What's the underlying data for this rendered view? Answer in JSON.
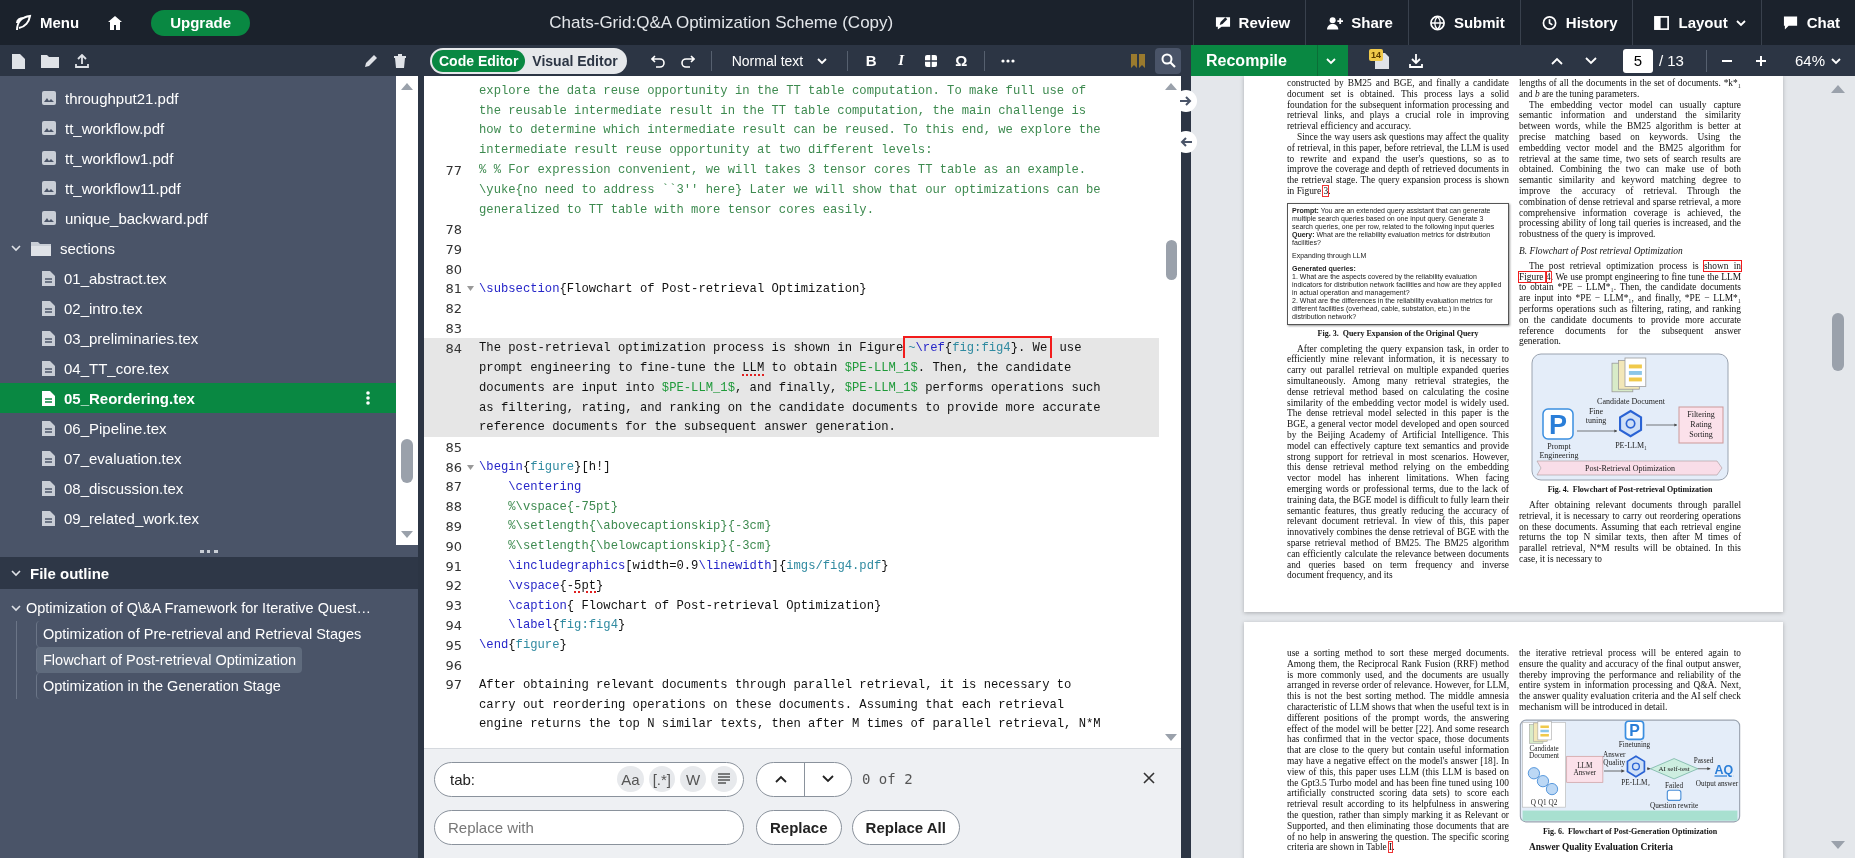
{
  "menu_bar": {
    "menu": "Menu",
    "upgrade": "Upgrade",
    "title": "Chats-Grid:Q&A Optimization Scheme (Copy)",
    "actions": [
      {
        "kind": "review",
        "label": "Review",
        "dropdown": false
      },
      {
        "kind": "share",
        "label": "Share",
        "dropdown": false
      },
      {
        "kind": "submit",
        "label": "Submit",
        "dropdown": false
      },
      {
        "kind": "history",
        "label": "History",
        "dropdown": false
      },
      {
        "kind": "layout",
        "label": "Layout",
        "dropdown": true
      },
      {
        "kind": "chat",
        "label": "Chat",
        "dropdown": false
      }
    ]
  },
  "file_tree": {
    "items": [
      {
        "kind": "image",
        "name": "throughput21.pdf",
        "selected": false
      },
      {
        "kind": "image",
        "name": "tt_workflow.pdf",
        "selected": false
      },
      {
        "kind": "image",
        "name": "tt_workflow1.pdf",
        "selected": false
      },
      {
        "kind": "image",
        "name": "tt_workflow11.pdf",
        "selected": false
      },
      {
        "kind": "image",
        "name": "unique_backward.pdf",
        "selected": false
      },
      {
        "kind": "folder",
        "name": "sections",
        "expanded": true,
        "selected": false,
        "children": [
          {
            "kind": "tex",
            "name": "01_abstract.tex",
            "selected": false
          },
          {
            "kind": "tex",
            "name": "02_intro.tex",
            "selected": false
          },
          {
            "kind": "tex",
            "name": "03_preliminaries.tex",
            "selected": false
          },
          {
            "kind": "tex",
            "name": "04_TT_core.tex",
            "selected": false
          },
          {
            "kind": "tex",
            "name": "05_Reordering.tex",
            "selected": true
          },
          {
            "kind": "tex",
            "name": "06_Pipeline.tex",
            "selected": false
          },
          {
            "kind": "tex",
            "name": "07_evaluation.tex",
            "selected": false
          },
          {
            "kind": "tex",
            "name": "08_discussion.tex",
            "selected": false
          },
          {
            "kind": "tex",
            "name": "09_related_work.tex",
            "selected": false
          }
        ]
      }
    ]
  },
  "file_outline": {
    "title": "File outline",
    "expanded": true,
    "items": [
      {
        "title": "Optimization of Q\\&A Framework for Iterative Quest…",
        "selected": false,
        "expanded": true,
        "children": [
          {
            "title": "Optimization of Pre-retrieval and Retrieval Stages",
            "selected": false
          },
          {
            "title": "Flowchart of Post-retrieval Optimization",
            "selected": true
          },
          {
            "title": "Optimization in the Generation Stage",
            "selected": false
          }
        ]
      }
    ]
  },
  "editor_toolbar": {
    "modes": [
      {
        "label": "Code Editor",
        "selected": true
      },
      {
        "label": "Visual Editor",
        "selected": false
      }
    ],
    "text_style": "Normal text",
    "bold": "B",
    "italic": "I",
    "symbol": "Ω",
    "search_open": true
  },
  "editor": {
    "lines": [
      {
        "active": false,
        "segments": [
          {
            "kind": "comment",
            "text": "explore the data reuse opportunity in the TT table computation. To make full use of"
          }
        ]
      },
      {
        "active": false,
        "segments": [
          {
            "kind": "comment",
            "text": "the reusable intermediate result in the TT table computation, the main challenge is"
          }
        ]
      },
      {
        "active": false,
        "segments": [
          {
            "kind": "comment",
            "text": "how to determine which intermediate result can be reused. To this end, we explore the"
          }
        ]
      },
      {
        "active": false,
        "segments": [
          {
            "kind": "comment",
            "text": "intermediate result reuse opportunity at two different levels:"
          }
        ]
      },
      {
        "number": "77",
        "active": false,
        "foldable": false,
        "segments": [
          {
            "kind": "comment",
            "text": "% % For expression convenient, we will takes 3 tensor cores TT table as an example."
          }
        ]
      },
      {
        "active": false,
        "segments": [
          {
            "kind": "comment",
            "text": "\\yuke{no need to address ``3'' here} Later we will show that our optimizations can be"
          }
        ]
      },
      {
        "active": false,
        "segments": [
          {
            "kind": "comment",
            "text": "generalized to TT table with more tensor cores easily."
          }
        ]
      },
      {
        "number": "78",
        "active": false,
        "foldable": false
      },
      {
        "number": "79",
        "active": false,
        "foldable": false
      },
      {
        "number": "80",
        "active": false,
        "foldable": false
      },
      {
        "number": "81",
        "active": false,
        "foldable": true,
        "segments": [
          {
            "kind": "command",
            "text": "\\subsection"
          },
          {
            "kind": "text",
            "text": "{Flowchart of Post-retrieval Optimization}"
          }
        ]
      },
      {
        "number": "82",
        "active": false,
        "foldable": false
      },
      {
        "number": "83",
        "active": false,
        "foldable": false
      },
      {
        "number": "84",
        "active": true,
        "foldable": false,
        "segments": [
          {
            "kind": "text",
            "text": "The post-retrieval optimization process is shown in Figure"
          },
          {
            "kind": "annotation",
            "segments": [
              {
                "kind": "argument",
                "text": "~"
              },
              {
                "kind": "command",
                "text": "\\ref"
              },
              {
                "kind": "text",
                "text": "{"
              },
              {
                "kind": "argument",
                "text": "fig:fig4"
              },
              {
                "kind": "text",
                "text": "}. We"
              }
            ]
          },
          {
            "kind": "text",
            "text": " use"
          }
        ]
      },
      {
        "active": true,
        "segments": [
          {
            "kind": "text",
            "text": "prompt engineering to fine-tune the "
          },
          {
            "kind": "misspelled",
            "text": "LLM"
          },
          {
            "kind": "text",
            "text": " to obtain "
          },
          {
            "kind": "math",
            "text": "$PE-LLM_1$"
          },
          {
            "kind": "text",
            "text": ". Then, the candidate"
          }
        ]
      },
      {
        "active": true,
        "segments": [
          {
            "kind": "text",
            "text": "documents are input into "
          },
          {
            "kind": "math",
            "text": "$PE-LLM_1$"
          },
          {
            "kind": "text",
            "text": ", and finally, "
          },
          {
            "kind": "math",
            "text": "$PE-LLM_1$"
          },
          {
            "kind": "text",
            "text": " performs operations such"
          }
        ]
      },
      {
        "active": true,
        "segments": [
          {
            "kind": "text",
            "text": "as filtering, rating, and ranking on the candidate documents to provide more accurate"
          }
        ]
      },
      {
        "active": true,
        "segments": [
          {
            "kind": "text",
            "text": "reference documents for the subsequent answer generation."
          }
        ]
      },
      {
        "number": "85",
        "active": false,
        "foldable": false
      },
      {
        "number": "86",
        "active": false,
        "foldable": true,
        "segments": [
          {
            "kind": "command",
            "text": "\\begin"
          },
          {
            "kind": "text",
            "text": "{"
          },
          {
            "kind": "argument",
            "text": "figure"
          },
          {
            "kind": "text",
            "text": "}[h!]"
          }
        ]
      },
      {
        "number": "87",
        "active": false,
        "foldable": false,
        "segments": [
          {
            "kind": "command",
            "text": "    \\centering"
          }
        ]
      },
      {
        "number": "88",
        "active": false,
        "foldable": false,
        "segments": [
          {
            "kind": "comment",
            "text": "    %\\vspace{-75pt}"
          }
        ]
      },
      {
        "number": "89",
        "active": false,
        "foldable": false,
        "segments": [
          {
            "kind": "comment",
            "text": "    %\\setlength{\\abovecaptionskip}{-3cm}"
          }
        ]
      },
      {
        "number": "90",
        "active": false,
        "foldable": false,
        "segments": [
          {
            "kind": "comment",
            "text": "    %\\setlength{\\belowcaptionskip}{-3cm}"
          }
        ]
      },
      {
        "number": "91",
        "active": false,
        "foldable": false,
        "segments": [
          {
            "kind": "command",
            "text": "    \\includegraphics"
          },
          {
            "kind": "text",
            "text": "[width=0.9"
          },
          {
            "kind": "command",
            "text": "\\linewidth"
          },
          {
            "kind": "text",
            "text": "]{"
          },
          {
            "kind": "argument",
            "text": "imgs/fig4.pdf"
          },
          {
            "kind": "text",
            "text": "}"
          }
        ]
      },
      {
        "number": "92",
        "active": false,
        "foldable": false,
        "segments": [
          {
            "kind": "command",
            "text": "    \\vspace"
          },
          {
            "kind": "text",
            "text": "{-"
          },
          {
            "kind": "misspelled",
            "text": "5pt"
          },
          {
            "kind": "text",
            "text": "}"
          }
        ]
      },
      {
        "number": "93",
        "active": false,
        "foldable": false,
        "segments": [
          {
            "kind": "command",
            "text": "    \\caption"
          },
          {
            "kind": "text",
            "text": "{ Flowchart of Post-retrieval Optimization}"
          }
        ]
      },
      {
        "number": "94",
        "active": false,
        "foldable": false,
        "segments": [
          {
            "kind": "command",
            "text": "    \\label"
          },
          {
            "kind": "text",
            "text": "{"
          },
          {
            "kind": "argument",
            "text": "fig:fig4"
          },
          {
            "kind": "text",
            "text": "}"
          }
        ]
      },
      {
        "number": "95",
        "active": false,
        "foldable": false,
        "segments": [
          {
            "kind": "command",
            "text": "\\end"
          },
          {
            "kind": "text",
            "text": "{"
          },
          {
            "kind": "argument",
            "text": "figure"
          },
          {
            "kind": "text",
            "text": "}"
          }
        ]
      },
      {
        "number": "96",
        "active": false,
        "foldable": false
      },
      {
        "number": "97",
        "active": false,
        "foldable": false,
        "segments": [
          {
            "kind": "text",
            "text": "After obtaining relevant documents through parallel retrieval, it is necessary to"
          }
        ]
      },
      {
        "active": false,
        "segments": [
          {
            "kind": "text",
            "text": "carry out reordering operations on these documents. Assuming that each retrieval"
          }
        ]
      },
      {
        "active": false,
        "segments": [
          {
            "kind": "text",
            "text": "engine returns the top N similar texts, then after M times of parallel retrieval, N*M"
          }
        ]
      }
    ]
  },
  "search": {
    "query": "tab:",
    "options": [
      "Aa",
      "[.*]",
      "W"
    ],
    "match_count": "0 of 2",
    "replace_placeholder": "Replace with",
    "buttons": [
      "Replace",
      "Replace All"
    ]
  },
  "pdf_toolbar": {
    "recompile": "Recompile",
    "log_count": "14",
    "page": "5",
    "page_total": "/ 13",
    "zoom": "64%"
  },
  "pdf": {
    "pages": [
      {
        "columns": [
          [
            {
              "kind": "para",
              "indent": false,
              "text": "constructed by BM25 and BGE, and finally a candidate document set is obtained. This process lays a solid foundation for the subsequent information processing and retrieval links, and plays a crucial role in improving retrieval efficiency and accuracy."
            },
            {
              "kind": "para",
              "indent": true,
              "runs": [
                {
                  "kind": "text",
                  "text": "Since the way users ask questions may affect the quality of retrieval, in this paper, before retrieval, the LLM is used to rewrite and expand the user's questions, so as to improve the coverage and depth of retrieved documents in the retrieval stage. The query expansion process is shown in Figure "
                },
                {
                  "kind": "link",
                  "text": "3"
                },
                {
                  "kind": "text",
                  "text": "."
                }
              ]
            },
            {
              "kind": "query_box",
              "groups": [
                [
                  "**Prompt:** You are an extended query assistant that can generate multiple search queries based on one input query. Generate 3 search queries, one per row, related to the following input queries",
                  "**Query:** What are the reliability evaluation metrics for distribution facilities?"
                ],
                [
                  "Expanding through LLM"
                ],
                [
                  "**Generated queries:**",
                  "1. What are the aspects covered by the reliability evaluation indicators for distribution network facilities and how are they applied in actual operation and management?",
                  "2. What are the differences in the reliability evaluation metrics for different facilities (overhead, cable, substation, etc.) in the distribution network?"
                ]
              ]
            },
            {
              "kind": "caption",
              "text": "Fig. 3.  Query Expansion of the Original Query"
            },
            {
              "kind": "para",
              "indent": true,
              "text": "After completing the query expansion task, in order to efficiently mine relevant information, it is necessary to carry out parallel retrieval on multiple expanded queries simultaneously. Among many retrieval strategies, the dense retrieval method based on calculating the cosine similarity of the embedding vector model is widely used. The dense retrieval model selected in this paper is the BGE, a general vector model developed and open sourced by the Beijing Academy of Artificial Intelligence. This model can effectively capture text semantics and provide strong support for retrieval in most scenarios. However, this dense retrieval method relying on the embedding vector model has inherent limitations. When facing emerging words or professional terms, due to the lack of training data, the BGE model is difficult to fully learn their semantic features, thus greatly reducing the accuracy of relevant document retrieval. In view of this, this paper innovatively combines the dense retrieval of BGE with the sparse retrieval method of BM25. The BM25 algorithm can efficiently calculate the relevance between documents and queries based on term frequency and inverse document frequency, and its"
            }
          ],
          [
            {
              "kind": "para",
              "indent": false,
              "text": "lengths of all the documents in the set of documents. *k*₁ and *b* are the tuning parameters."
            },
            {
              "kind": "para",
              "indent": true,
              "text": "The embedding vector model can usually capture semantic information and understand the similarity between words, while the BM25 algorithm is better at precise matching based on keywords. Using the embedding vector model and the BM25 algorithm for retrieval at the same time, two sets of search results are obtained. Combining the two can make use of both semantic similarity and keyword matching degree to improve the accuracy of retrieval. Through the combination of dense retrieval and sparse retrieval, a more comprehensive information coverage is achieved, the processing ability of long tail queries is increased, and the robustness of the query is improved."
            },
            {
              "kind": "heading",
              "text": "B. Flowchart of Post retrieval Optimization"
            },
            {
              "kind": "para",
              "indent": true,
              "runs": [
                {
                  "kind": "text",
                  "text": "The post retrieval optimization process is "
                },
                {
                  "kind": "annotation",
                  "text": "shown in Figure "
                },
                {
                  "kind": "link",
                  "text": "4"
                },
                {
                  "kind": "text",
                  "text": ". We use prompt engineering to fine tune the LLM to obtain *PE − LLM*₁. Then, the candidate documents are input into *PE − LLM*₁, and finally, *PE − LLM*₁ performs operations such as filtering, rating, and ranking on the candidate documents to provide more accurate reference documents for the subsequent answer generation."
                }
              ]
            },
            {
              "kind": "flow_retrieval",
              "labels": {
                "candidate": "Candidate Document",
                "fine_tuning": [
                  "Fine",
                  "tuning"
                ],
                "prompt_mark": "P",
                "prompt": [
                  "Prompt",
                  "Engineering"
                ],
                "model": "PE-LLM₁",
                "output": [
                  "Filtering",
                  "Rating",
                  "Sorting"
                ],
                "banner": "Post-Retrieval Optimization"
              }
            },
            {
              "kind": "caption",
              "text": "Fig. 4.  Flowchart of Post-retrieval Optimization"
            },
            {
              "kind": "para",
              "indent": true,
              "text": "After obtaining relevant documents through parallel retrieval, it is necessary to carry out reordering operations on these documents. Assuming that each retrieval engine returns the top N similar texts, then after M times of parallel retrieval, N*M results will be obtained. In this case, it is necessary to"
            }
          ]
        ]
      },
      {
        "columns": [
          [
            {
              "kind": "para",
              "indent": false,
              "runs": [
                {
                  "kind": "text",
                  "text": "use a sorting method to sort these merged documents. Among them, the Reciprocal Rank Fusion (RRF) method is more commonly used, and the documents are usually arranged in reverse order of relevance. However, for LLM, this is not the best sorting method. The middle amnesia characteristic of LLM shows that when the useful text is in different positions of the prompt words, the answering effect of the model will be better [22]. And some research has confirmed that in the vector space, those documents that are close to the query but contain useful information may have a negative effect on the model's answer [18]. In view of this, this paper uses LLM (this LLM is based on the Gpt3.5 Turbo model and has been fine tuned using 100 artificially constructed scoring data sets) to score each retrieval result according to its helpfulness in answering the question, rather than simply marking it as Relevant or Supported, and then eliminating those documents that are of no help in answering the question. The specific scoring criteria are shown in Table "
                },
                {
                  "kind": "link",
                  "text": "I"
                },
                {
                  "kind": "text",
                  "text": "."
                }
              ]
            }
          ],
          [
            {
              "kind": "para",
              "indent": false,
              "text": "the iterative retrieval process will be entered again to ensure the quality and accuracy of the final output answer, thereby improving the performance and reliability of the entire system in information processing and Q&A. Next, the answer quality evaluation criteria and the AI self check mechanism will be introduced in detail."
            },
            {
              "kind": "flow_generation",
              "labels": {
                "candidate": [
                  "Candidate",
                  "Document"
                ],
                "queries": "Q Q1 Q2",
                "answer": [
                  "LLM",
                  "Answer"
                ],
                "quality": [
                  "Answer",
                  "Quality"
                ],
                "prompt_mark": "P",
                "finetune": "Finetuning",
                "model": "PE-LLM₂",
                "check": "AI self-test",
                "passed": "Passed",
                "failed": "Failed",
                "output_mark": "AQ",
                "output": "Output answer",
                "rewrite": "Question rewrite"
              }
            },
            {
              "kind": "caption",
              "text": "Fig. 6.  Flowchart of Post-Generation Optimization"
            },
            {
              "kind": "subheading",
              "text": "Answer Quality Evaluation Criteria"
            }
          ]
        ]
      }
    ]
  }
}
